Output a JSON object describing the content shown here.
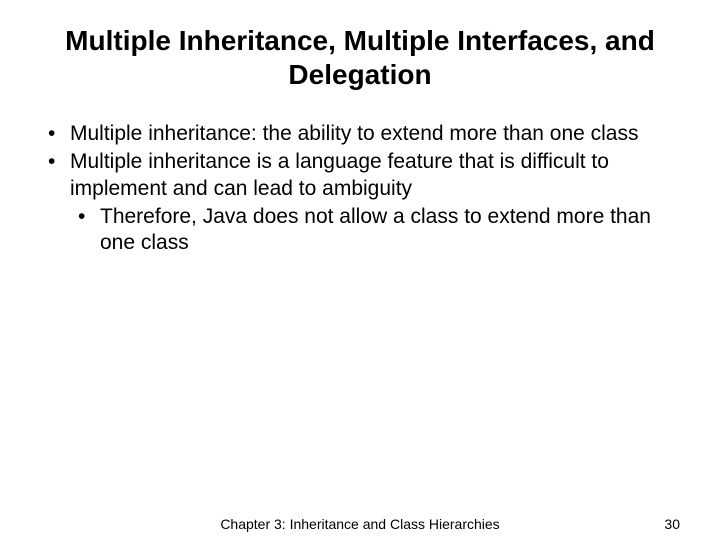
{
  "title": "Multiple Inheritance, Multiple Interfaces, and Delegation",
  "bullets": {
    "item1": "Multiple inheritance: the ability to extend more than one class",
    "item2": "Multiple inheritance is a language feature that is difficult to implement and can lead to ambiguity",
    "item2_sub1": "Therefore, Java does not allow a class to extend more than one class"
  },
  "footer": {
    "chapter": "Chapter 3: Inheritance and Class Hierarchies",
    "page": "30"
  }
}
